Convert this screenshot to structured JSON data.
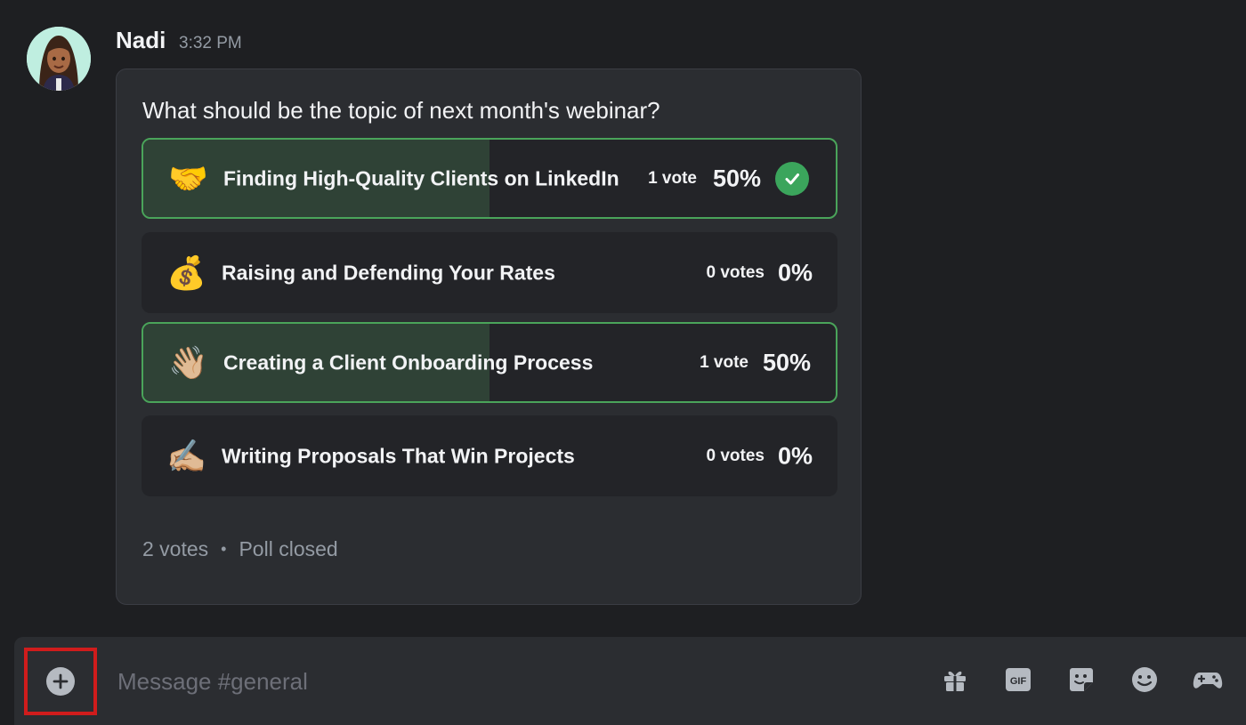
{
  "message": {
    "author": "Nadi",
    "timestamp": "3:32 PM"
  },
  "poll": {
    "question": "What should be the topic of next month's webinar?",
    "answers": [
      {
        "emoji": "🤝",
        "label": "Finding High-Quality Clients on LinkedIn",
        "votes": "1 vote",
        "percent": "50%",
        "fill_fraction": 0.5,
        "winner": true
      },
      {
        "emoji": "💰",
        "label": "Raising and Defending Your Rates",
        "votes": "0 votes",
        "percent": "0%",
        "fill_fraction": 0,
        "winner": false
      },
      {
        "emoji": "👋🏼",
        "label": "Creating a Client Onboarding Process",
        "votes": "1 vote",
        "percent": "50%",
        "fill_fraction": 0.5,
        "winner": true
      },
      {
        "emoji": "✍🏼",
        "label": "Writing Proposals That Win Projects",
        "votes": "0 votes",
        "percent": "0%",
        "fill_fraction": 0,
        "winner": false
      }
    ],
    "total_votes": "2 votes",
    "separator": "•",
    "status": "Poll closed"
  },
  "composer": {
    "placeholder": "Message #general",
    "gif_label": "GIF",
    "icons": [
      "add-icon",
      "gift-icon",
      "gif-icon",
      "sticker-icon",
      "emoji-icon",
      "activity-icon"
    ]
  },
  "colors": {
    "background": "#1e1f22",
    "poll_card": "#2b2d31",
    "winner_border": "#4aa45a",
    "winner_fill": "#2f4236",
    "check": "#3ba55c",
    "highlight_box": "#d01c1c"
  }
}
